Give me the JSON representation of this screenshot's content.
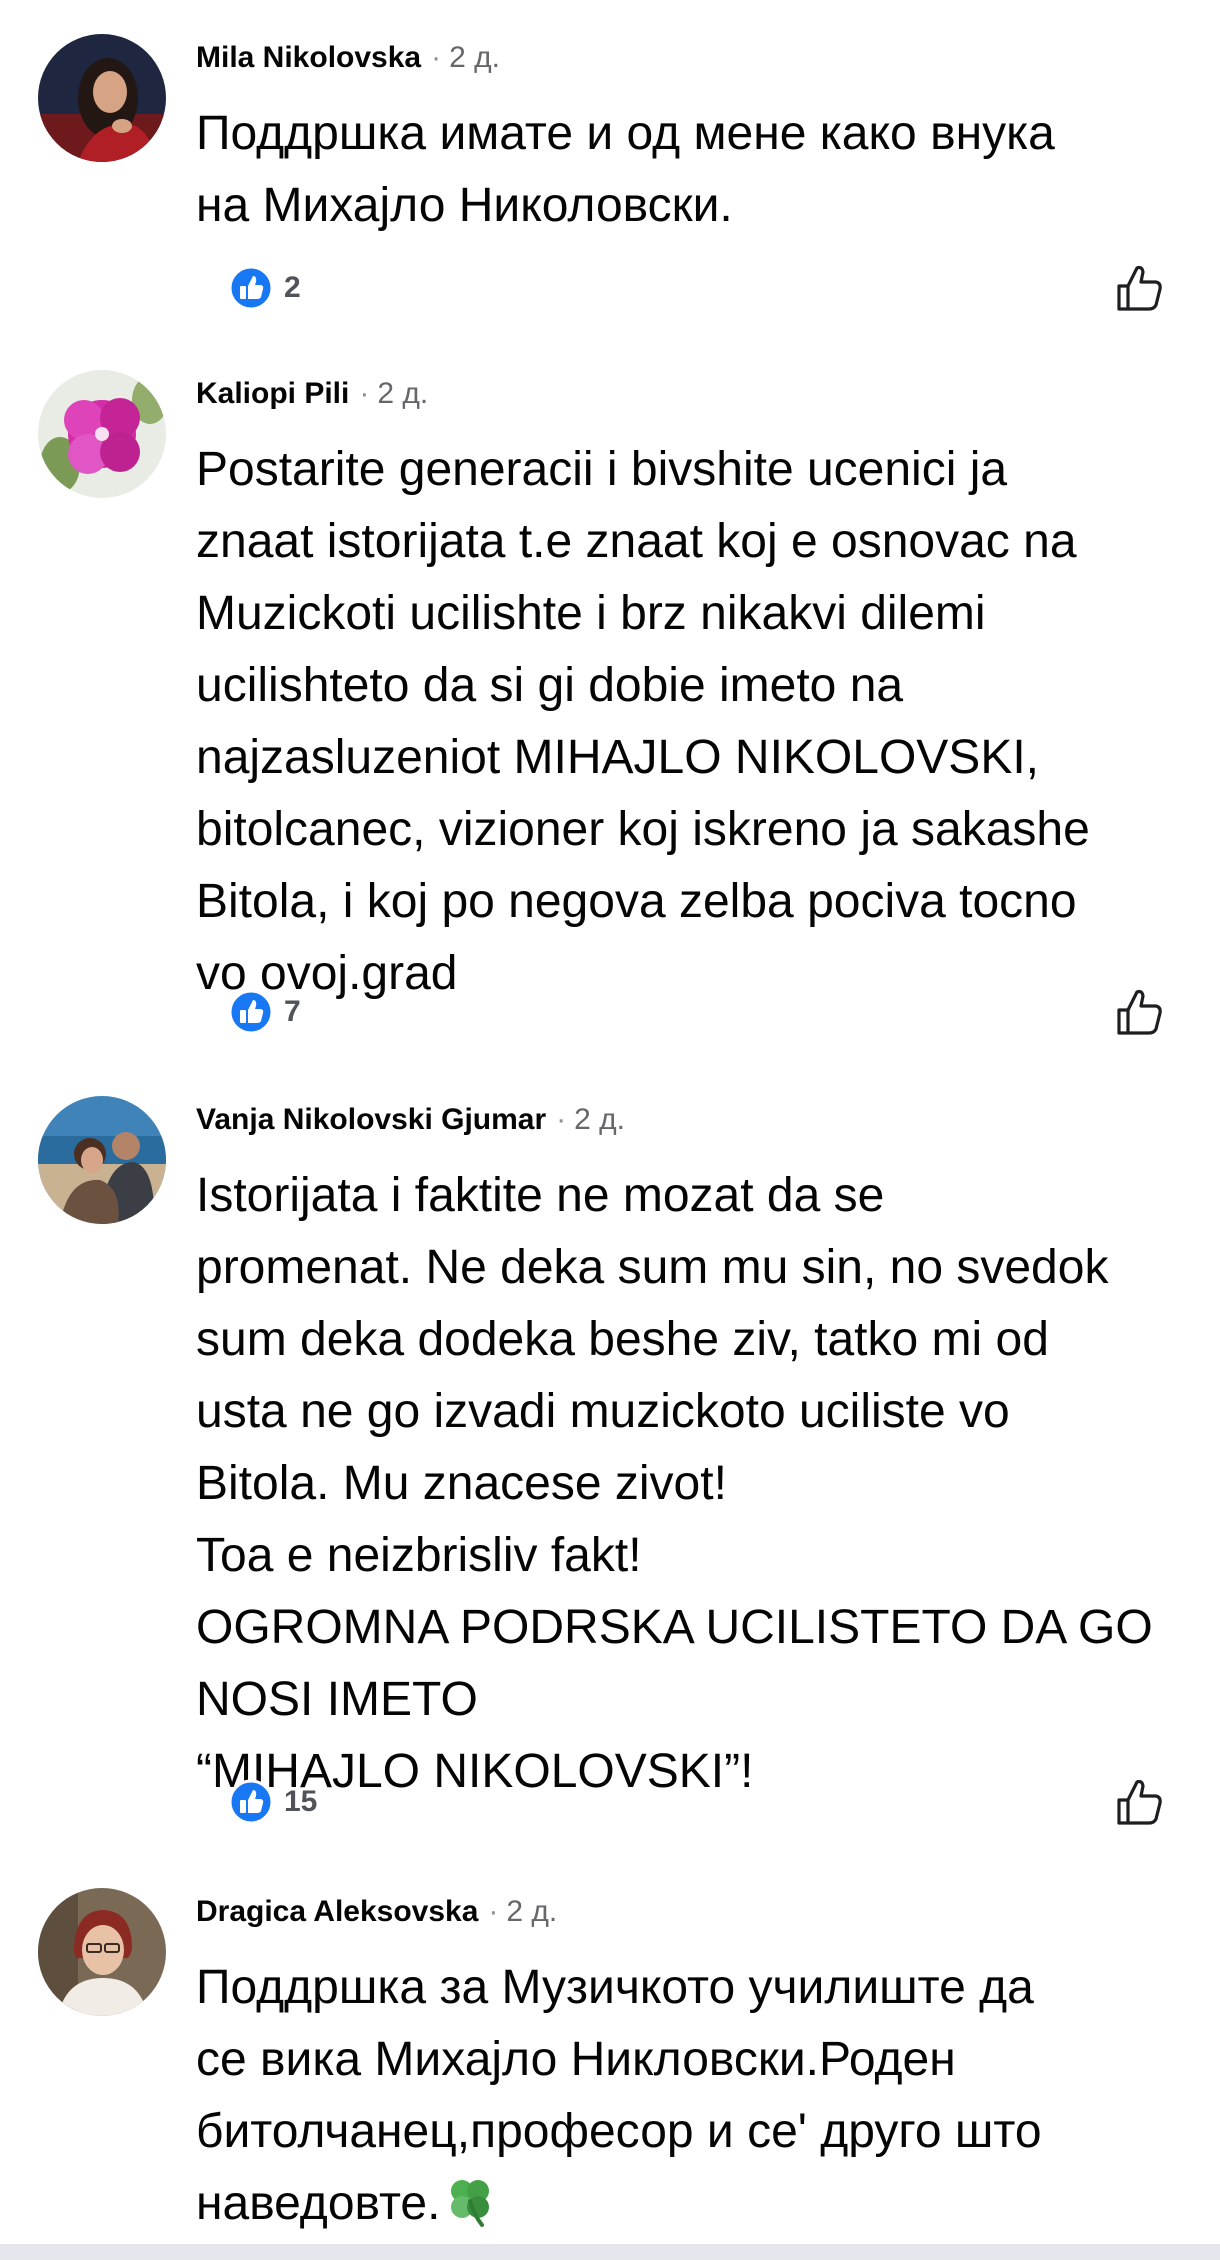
{
  "comments": [
    {
      "author": "Mila Nikolovska",
      "time": "2 д.",
      "text": "Поддршка имате и од мене како внука\nна Михајло Николовски.",
      "reactions": "2"
    },
    {
      "author": "Kaliopi Pili",
      "time": "2 д.",
      "text": "Postarite generacii i bivshite ucenici ja\nznaat istorijata t.e znaat koj e osnovac na\nMuzickoti ucilishte i brz nikakvi dilemi\nucilishteto da si gi dobie imeto na\nnajzasluzeniot MIHAJLO  NIKOLOVSKI,\nbitolcanec, vizioner koj iskreno ja sakashe\nBitola, i koj po negova zelba pociva tocno\nvo ovoj.grad",
      "reactions": "7"
    },
    {
      "author": "Vanja Nikolovski Gjumar",
      "time": "2 д.",
      "text": "Istorijata i faktite ne mozat da se\npromenat. Ne deka sum mu sin, no svedok\nsum deka dodeka beshe ziv, tatko mi od\nusta ne go izvadi muzickoto uciliste vo\nBitola. Mu znacese zivot!\nToa e neizbrisliv fakt!\nOGROMNA PODRSKA UCILISTETO DA GO\nNOSI IMETO\n“MIHAJLO NIKOLOVSKI”!",
      "reactions": "15"
    },
    {
      "author": "Dragica Aleksovska",
      "time": "2 д.",
      "text": "Поддршка за Музичкото училиште да\nсе вика Михајло Никловски.Роден\nбитолчанец,професор и се' друго што\nнаведовте.",
      "emoji": "four-leaf-clover-icon"
    }
  ],
  "colors": {
    "like_blue": "#1877f2",
    "meta_gray": "#65676b",
    "text": "#050505",
    "count_gray": "#50535a"
  }
}
